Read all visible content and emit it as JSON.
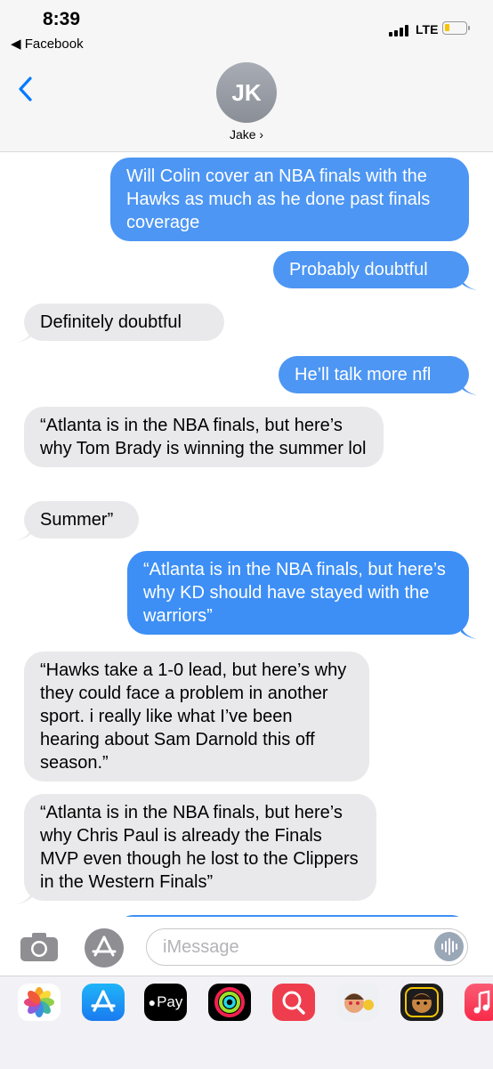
{
  "status_bar": {
    "time": "8:39",
    "back_app": "◀ Facebook",
    "network": "LTE"
  },
  "header": {
    "avatar_initials": "JK",
    "contact_name": "Jake ›"
  },
  "messages": [
    {
      "direction": "outgoing",
      "text": "Will Colin cover an NBA finals with the Hawks as much as he done past finals coverage"
    },
    {
      "direction": "outgoing",
      "text": "Probably doubtful"
    },
    {
      "direction": "incoming",
      "text": "Definitely doubtful"
    },
    {
      "direction": "outgoing",
      "text": "He’ll talk more nfl"
    },
    {
      "direction": "incoming",
      "text": "“Atlanta is in the NBA finals, but here’s why Tom Brady is winning the summer lol"
    },
    {
      "direction": "incoming",
      "text": "Summer”"
    },
    {
      "direction": "outgoing",
      "text": "“Atlanta is in the NBA finals, but here’s why KD should have stayed with the warriors”"
    },
    {
      "direction": "incoming",
      "text": "“Hawks take a 1-0 lead, but here’s why they could face a problem in another sport. i really like what I’ve been hearing about Sam Darnold this off season.”"
    },
    {
      "direction": "incoming",
      "text": "“Atlanta is in the NBA finals, but here’s why Chris Paul is already the Finals MVP even though he lost to the Clippers in the Western Finals”"
    }
  ],
  "composer": {
    "placeholder": "iMessage"
  },
  "app_drawer": [
    {
      "name": "photos-icon"
    },
    {
      "name": "app-store-icon"
    },
    {
      "name": "apple-pay-icon",
      "label": "Pay"
    },
    {
      "name": "activity-icon"
    },
    {
      "name": "search-images-icon"
    },
    {
      "name": "memoji-stickers-icon"
    },
    {
      "name": "animoji-icon"
    },
    {
      "name": "music-icon"
    }
  ],
  "colors": {
    "outgoing_bubble": "#3d8ff5",
    "incoming_bubble": "#e9e9eb",
    "accent": "#007aff"
  }
}
